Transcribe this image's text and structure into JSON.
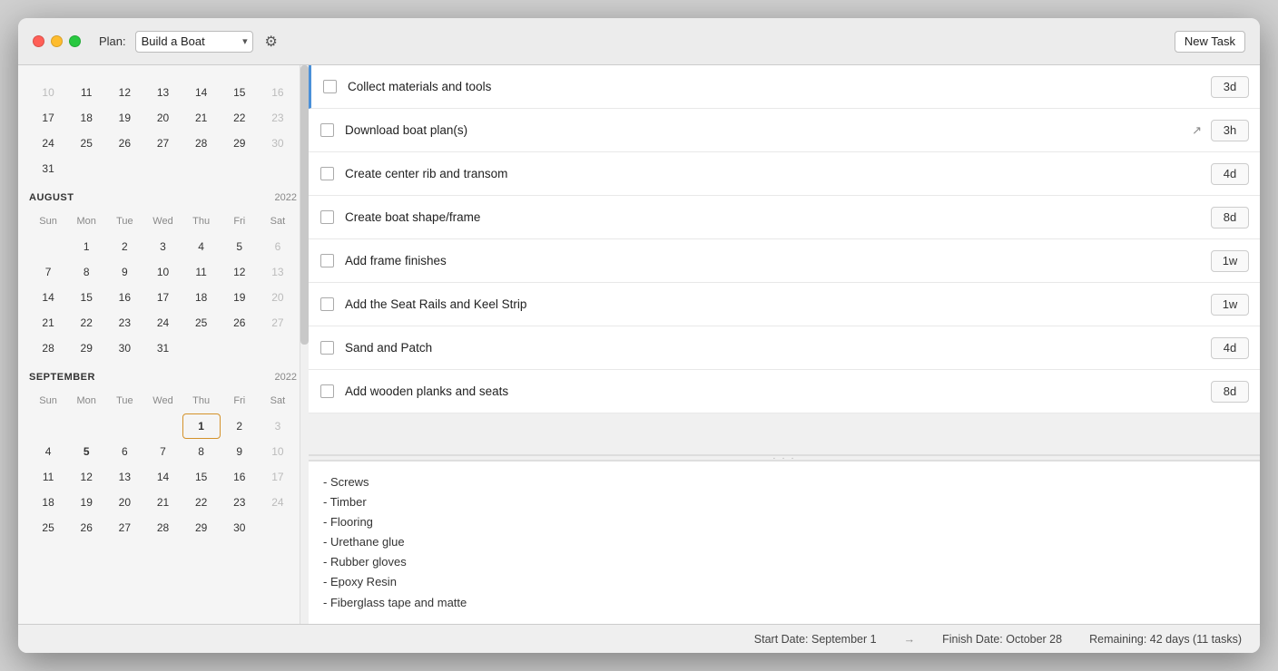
{
  "titlebar": {
    "plan_label": "Plan:",
    "plan_value": "Build a Boat",
    "new_task_label": "New Task"
  },
  "calendar": {
    "months": [
      {
        "name": "AUGUST",
        "year": "2022",
        "days_header": [
          "Sun",
          "Mon",
          "Tue",
          "Wed",
          "Thu",
          "Fri",
          "Sat"
        ],
        "weeks": [
          [
            {
              "n": "",
              "type": "empty"
            },
            {
              "n": "1",
              "type": "normal"
            },
            {
              "n": "2",
              "type": "normal"
            },
            {
              "n": "3",
              "type": "normal"
            },
            {
              "n": "4",
              "type": "normal"
            },
            {
              "n": "5",
              "type": "normal"
            },
            {
              "n": "6",
              "type": "overflow"
            }
          ],
          [
            {
              "n": "7",
              "type": "normal"
            },
            {
              "n": "8",
              "type": "normal"
            },
            {
              "n": "9",
              "type": "normal"
            },
            {
              "n": "10",
              "type": "normal"
            },
            {
              "n": "11",
              "type": "normal"
            },
            {
              "n": "12",
              "type": "normal"
            },
            {
              "n": "13",
              "type": "overflow"
            }
          ],
          [
            {
              "n": "14",
              "type": "normal"
            },
            {
              "n": "15",
              "type": "normal"
            },
            {
              "n": "16",
              "type": "normal"
            },
            {
              "n": "17",
              "type": "normal"
            },
            {
              "n": "18",
              "type": "normal"
            },
            {
              "n": "19",
              "type": "normal"
            },
            {
              "n": "20",
              "type": "overflow"
            }
          ],
          [
            {
              "n": "21",
              "type": "normal"
            },
            {
              "n": "22",
              "type": "normal"
            },
            {
              "n": "23",
              "type": "normal"
            },
            {
              "n": "24",
              "type": "normal"
            },
            {
              "n": "25",
              "type": "normal"
            },
            {
              "n": "26",
              "type": "normal"
            },
            {
              "n": "27",
              "type": "overflow"
            }
          ],
          [
            {
              "n": "28",
              "type": "normal"
            },
            {
              "n": "29",
              "type": "normal"
            },
            {
              "n": "30",
              "type": "normal"
            },
            {
              "n": "31",
              "type": "normal"
            },
            {
              "n": "",
              "type": "empty"
            },
            {
              "n": "",
              "type": "empty"
            },
            {
              "n": "",
              "type": "empty"
            }
          ]
        ]
      },
      {
        "name": "SEPTEMBER",
        "year": "2022",
        "days_header": [
          "Sun",
          "Mon",
          "Tue",
          "Wed",
          "Thu",
          "Fri",
          "Sat"
        ],
        "weeks": [
          [
            {
              "n": "",
              "type": "empty"
            },
            {
              "n": "",
              "type": "empty"
            },
            {
              "n": "",
              "type": "empty"
            },
            {
              "n": "",
              "type": "empty"
            },
            {
              "n": "1",
              "type": "today"
            },
            {
              "n": "2",
              "type": "normal"
            },
            {
              "n": "3",
              "type": "overflow"
            }
          ],
          [
            {
              "n": "4",
              "type": "normal"
            },
            {
              "n": "5",
              "type": "bold"
            },
            {
              "n": "6",
              "type": "normal"
            },
            {
              "n": "7",
              "type": "normal"
            },
            {
              "n": "8",
              "type": "normal"
            },
            {
              "n": "9",
              "type": "normal"
            },
            {
              "n": "10",
              "type": "overflow"
            }
          ],
          [
            {
              "n": "11",
              "type": "normal"
            },
            {
              "n": "12",
              "type": "normal"
            },
            {
              "n": "13",
              "type": "normal"
            },
            {
              "n": "14",
              "type": "normal"
            },
            {
              "n": "15",
              "type": "normal"
            },
            {
              "n": "16",
              "type": "normal"
            },
            {
              "n": "17",
              "type": "overflow"
            }
          ],
          [
            {
              "n": "18",
              "type": "normal"
            },
            {
              "n": "19",
              "type": "normal"
            },
            {
              "n": "20",
              "type": "normal"
            },
            {
              "n": "21",
              "type": "normal"
            },
            {
              "n": "22",
              "type": "normal"
            },
            {
              "n": "23",
              "type": "normal"
            },
            {
              "n": "24",
              "type": "overflow"
            }
          ],
          [
            {
              "n": "25",
              "type": "normal"
            },
            {
              "n": "26",
              "type": "normal"
            },
            {
              "n": "27",
              "type": "normal"
            },
            {
              "n": "28",
              "type": "normal"
            },
            {
              "n": "29",
              "type": "normal"
            },
            {
              "n": "30",
              "type": "normal"
            },
            {
              "n": "",
              "type": "empty"
            }
          ]
        ]
      }
    ],
    "prev_weeks": {
      "row1": [
        "10",
        "11",
        "12",
        "13",
        "14",
        "15",
        "16"
      ],
      "row2": [
        "17",
        "18",
        "19",
        "20",
        "21",
        "22",
        "23"
      ],
      "row3": [
        "24",
        "25",
        "26",
        "27",
        "28",
        "29",
        "30"
      ],
      "row4": [
        "31"
      ]
    }
  },
  "tasks": [
    {
      "label": "Collect materials and tools",
      "duration": "3d",
      "checked": false,
      "has_link": false,
      "highlighted": true
    },
    {
      "label": "Download boat plan(s)",
      "duration": "3h",
      "checked": false,
      "has_link": true,
      "highlighted": false
    },
    {
      "label": "Create center rib and transom",
      "duration": "4d",
      "checked": false,
      "has_link": false,
      "highlighted": false
    },
    {
      "label": "Create boat shape/frame",
      "duration": "8d",
      "checked": false,
      "has_link": false,
      "highlighted": false
    },
    {
      "label": "Add frame finishes",
      "duration": "1w",
      "checked": false,
      "has_link": false,
      "highlighted": false
    },
    {
      "label": "Add the Seat Rails and Keel Strip",
      "duration": "1w",
      "checked": false,
      "has_link": false,
      "highlighted": false
    },
    {
      "label": "Sand and Patch",
      "duration": "4d",
      "checked": false,
      "has_link": false,
      "highlighted": false
    },
    {
      "label": "Add wooden planks and seats",
      "duration": "8d",
      "checked": false,
      "has_link": false,
      "highlighted": false
    }
  ],
  "notes": {
    "lines": [
      "- Screws",
      "- Timber",
      "- Flooring",
      "- Urethane glue",
      "- Rubber gloves",
      "- Epoxy Resin",
      "- Fiberglass tape and matte"
    ]
  },
  "status_bar": {
    "start_label": "Start Date: September 1",
    "arrow": "→",
    "finish_label": "Finish Date: October 28",
    "remaining_label": "Remaining: 42 days (11 tasks)"
  }
}
